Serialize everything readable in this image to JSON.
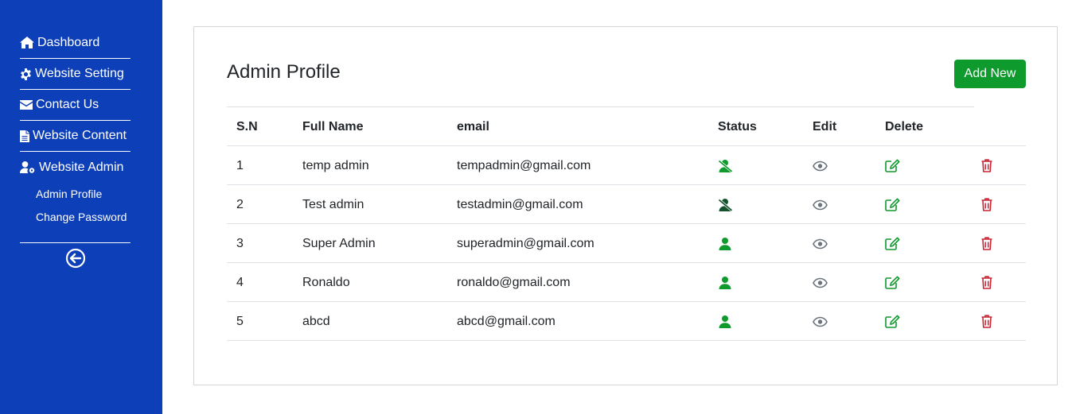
{
  "sidebar": {
    "items": [
      {
        "label": "Dashboard",
        "icon": "home-icon"
      },
      {
        "label": "Website Setting",
        "icon": "gear-icon"
      },
      {
        "label": "Contact Us",
        "icon": "envelope-icon"
      },
      {
        "label": "Website Content",
        "icon": "file-icon"
      },
      {
        "label": "Website Admin",
        "icon": "user-cog-icon"
      }
    ],
    "subitems": [
      {
        "label": "Admin Profile"
      },
      {
        "label": "Change Password"
      }
    ],
    "back_icon": "arrow-circle-left-icon"
  },
  "main": {
    "title": "Admin Profile",
    "add_button": "Add New",
    "columns": [
      "S.N",
      "Full Name",
      "email",
      "Status",
      "Edit",
      "Delete"
    ],
    "rows": [
      {
        "sn": "1",
        "name": "temp admin",
        "email": "tempadmin@gmail.com",
        "status": "inactive",
        "status_color": "#0e9a2c"
      },
      {
        "sn": "2",
        "name": "Test admin",
        "email": "testadmin@gmail.com",
        "status": "inactive",
        "status_color": "#14532d"
      },
      {
        "sn": "3",
        "name": "Super Admin",
        "email": "superadmin@gmail.com",
        "status": "active",
        "status_color": "#0e9a2c"
      },
      {
        "sn": "4",
        "name": "Ronaldo",
        "email": "ronaldo@gmail.com",
        "status": "active",
        "status_color": "#0e9a2c"
      },
      {
        "sn": "5",
        "name": "abcd",
        "email": "abcd@gmail.com",
        "status": "active",
        "status_color": "#0e9a2c"
      }
    ]
  },
  "colors": {
    "sidebar_bg": "#0d3fb8",
    "primary_green": "#0e9a2c",
    "delete_red": "#c82333",
    "view_gray": "#6c757d"
  }
}
